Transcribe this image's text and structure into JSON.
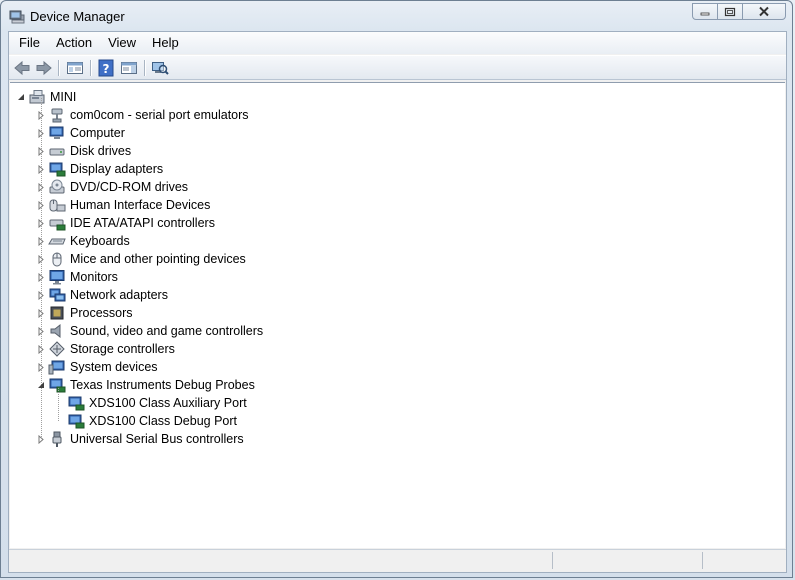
{
  "window": {
    "title": "Device Manager"
  },
  "menu": [
    "File",
    "Action",
    "View",
    "Help"
  ],
  "tree": {
    "root": "MINI",
    "categories": [
      {
        "label": "com0com - serial port emulators",
        "icon": "serial-port-icon"
      },
      {
        "label": "Computer",
        "icon": "computer-icon"
      },
      {
        "label": "Disk drives",
        "icon": "disk-drive-icon"
      },
      {
        "label": "Display adapters",
        "icon": "display-adapter-icon"
      },
      {
        "label": "DVD/CD-ROM drives",
        "icon": "dvd-drive-icon"
      },
      {
        "label": "Human Interface Devices",
        "icon": "hid-icon"
      },
      {
        "label": "IDE ATA/ATAPI controllers",
        "icon": "ide-controller-icon"
      },
      {
        "label": "Keyboards",
        "icon": "keyboard-icon"
      },
      {
        "label": "Mice and other pointing devices",
        "icon": "mouse-icon"
      },
      {
        "label": "Monitors",
        "icon": "monitor-icon"
      },
      {
        "label": "Network adapters",
        "icon": "network-adapter-icon"
      },
      {
        "label": "Processors",
        "icon": "processor-icon"
      },
      {
        "label": "Sound, video and game controllers",
        "icon": "sound-icon"
      },
      {
        "label": "Storage controllers",
        "icon": "storage-controller-icon"
      },
      {
        "label": "System devices",
        "icon": "system-devices-icon"
      },
      {
        "label": "Texas Instruments Debug Probes",
        "icon": "debug-probe-icon",
        "expanded": true,
        "children": [
          {
            "label": "XDS100 Class Auxiliary Port",
            "icon": "debug-port-icon"
          },
          {
            "label": "XDS100 Class Debug Port",
            "icon": "debug-port-icon"
          }
        ]
      },
      {
        "label": "Universal Serial Bus controllers",
        "icon": "usb-icon"
      }
    ]
  },
  "colors": {
    "accent": "#3a6ea5",
    "selection": "#cce8ff"
  }
}
